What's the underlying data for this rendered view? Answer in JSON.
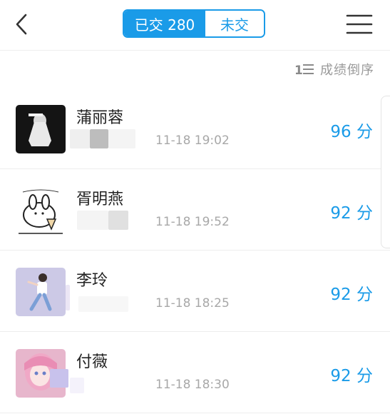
{
  "header": {
    "tabs": [
      {
        "label": "已交 280",
        "active": true
      },
      {
        "label": "未交",
        "active": false
      }
    ],
    "icons": {
      "back": "chevron-left-icon",
      "menu": "hamburger-menu-icon"
    }
  },
  "sort": {
    "label": "成绩倒序",
    "icon": "sort-descending-icon"
  },
  "submissions": [
    {
      "name": "蒲丽蓉",
      "time": "11-18 19:02",
      "score": "96 分"
    },
    {
      "name": "胥明燕",
      "time": "11-18 19:52",
      "score": "92 分"
    },
    {
      "name": "李玲",
      "time": "11-18 18:25",
      "score": "92 分"
    },
    {
      "name": "付薇",
      "time": "11-18 18:30",
      "score": "92 分"
    }
  ],
  "colors": {
    "accent": "#1a9be8",
    "text": "#222222",
    "muted": "#a8a8a8"
  }
}
